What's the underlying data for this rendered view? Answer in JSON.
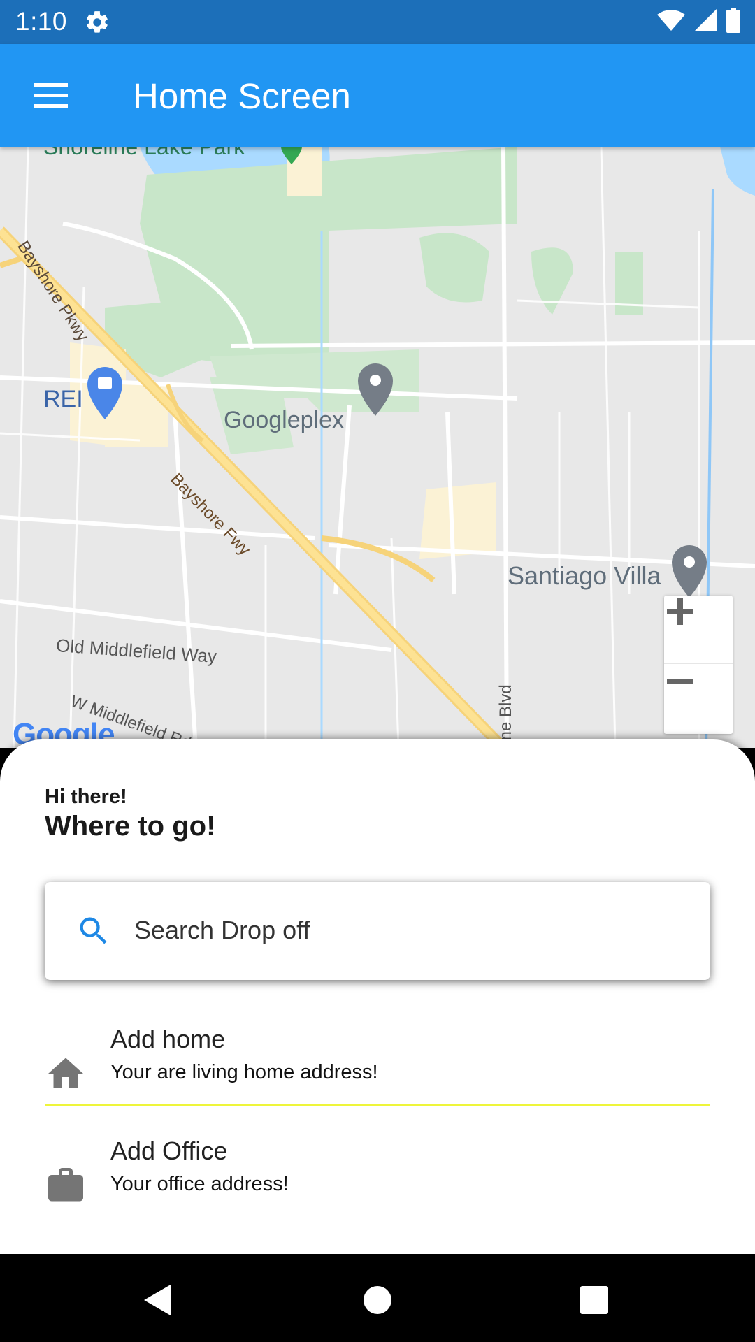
{
  "status_bar": {
    "time": "1:10",
    "icons": [
      "settings-icon",
      "wifi-icon",
      "signal-icon",
      "battery-icon"
    ]
  },
  "app_bar": {
    "title": "Home Screen",
    "menu_icon": "hamburger-menu-icon"
  },
  "map": {
    "labels": {
      "googleplex": "Googleplex",
      "santiago_villa": "Santiago Villa",
      "rei": "REI",
      "bayshore_pkwy": "Bayshore Pkwy",
      "bayshore_fwy": "Bayshore Fwy",
      "old_middlefield": "Old Middlefield Way",
      "w_middlefield": "W Middlefield Rd",
      "shoreline_blvd": "line Blvd",
      "shoreline_lake_park": "Shoreline Lake Park"
    },
    "google_logo": "Google",
    "zoom_in": "+",
    "zoom_out": "−"
  },
  "sheet": {
    "greeting": "Hi there!",
    "headline": "Where to go!",
    "search_placeholder": "Search Drop off",
    "places": [
      {
        "title": "Add home",
        "subtitle": "Your are living home address!",
        "icon": "home-icon"
      },
      {
        "title": "Add Office",
        "subtitle": "Your office address!",
        "icon": "briefcase-icon"
      }
    ]
  },
  "colors": {
    "status_bar": "#1c6fb9",
    "app_bar": "#2196f3",
    "divider": "#eef53a",
    "search_icon": "#1e88e5",
    "place_icon": "#757575"
  },
  "nav_bar": {
    "icons": [
      "back-icon",
      "home-circle-icon",
      "recents-icon"
    ]
  }
}
